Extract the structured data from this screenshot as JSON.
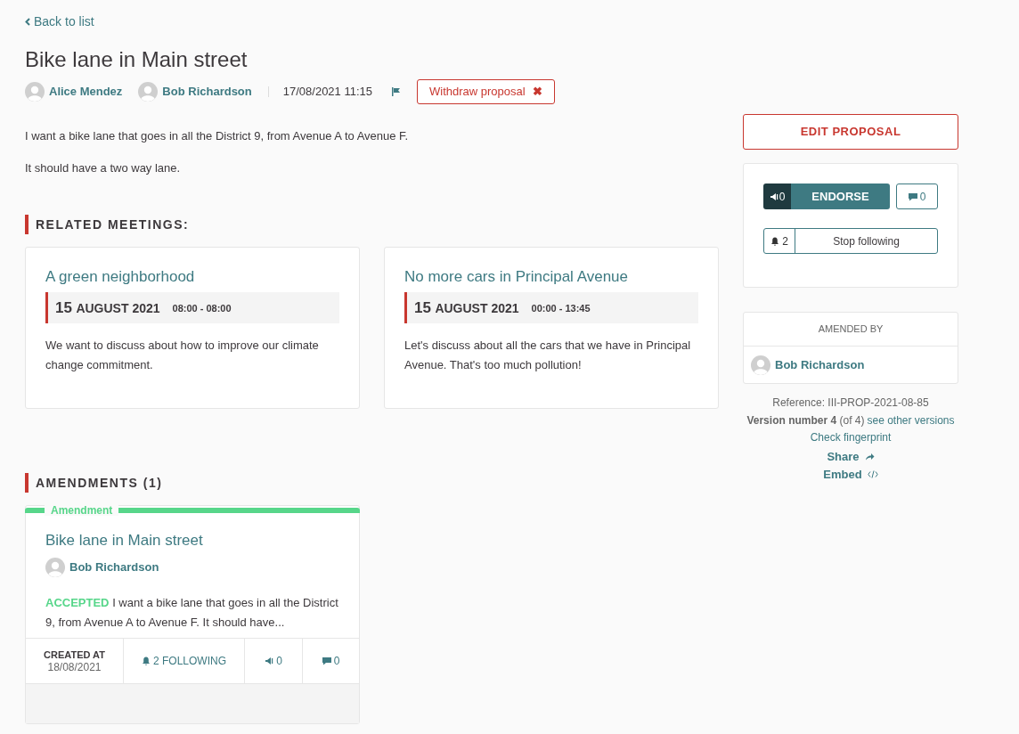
{
  "back_link": {
    "label": "Back to list"
  },
  "title": "Bike lane in Main street",
  "authors": [
    {
      "name": "Alice Mendez"
    },
    {
      "name": "Bob Richardson"
    }
  ],
  "date": "17/08/2021 11:15",
  "withdraw_button": {
    "label": "Withdraw proposal",
    "icon": "✖"
  },
  "body": [
    "I want a bike lane that goes in all the District 9, from Avenue A to Avenue F.",
    "It should have a two way lane."
  ],
  "related_meetings": {
    "heading": "RELATED MEETINGS:",
    "items": [
      {
        "title": "A green neighborhood",
        "day": "15",
        "month_year": "AUGUST 2021",
        "time": "08:00 - 08:00",
        "description": "We want to discuss about how to improve our climate change commitment."
      },
      {
        "title": "No more cars in Principal Avenue",
        "day": "15",
        "month_year": "AUGUST 2021",
        "time": "00:00 - 13:45",
        "description": "Let's discuss about all the cars that we have in Principal Avenue. That's too much pollution!"
      }
    ]
  },
  "amendments": {
    "heading": "AMENDMENTS (1)",
    "items": [
      {
        "tag": "Amendment",
        "title": "Bike lane in Main street",
        "author": "Bob Richardson",
        "status": "ACCEPTED",
        "summary": "I want a bike lane that goes in all the District 9, from Avenue A to Avenue F. It should have...",
        "created_label": "CREATED AT",
        "created_date": "18/08/2021",
        "following": "2 FOLLOWING",
        "endorsements": "0",
        "comments": "0"
      }
    ]
  },
  "sidebar": {
    "edit_button": "EDIT PROPOSAL",
    "endorsements_count": "0",
    "endorse_button": "ENDORSE",
    "comments_count": "0",
    "followers_count": "2",
    "follow_button": "Stop following",
    "amended_by": {
      "heading": "AMENDED BY",
      "name": "Bob Richardson"
    },
    "reference": "Reference: III-PROP-2021-08-85",
    "version": "**Version number 4** (of 4)",
    "versions_link": "see other versions",
    "fingerprint_link": "Check fingerprint",
    "share_link": "Share",
    "embed_link": "Embed"
  }
}
